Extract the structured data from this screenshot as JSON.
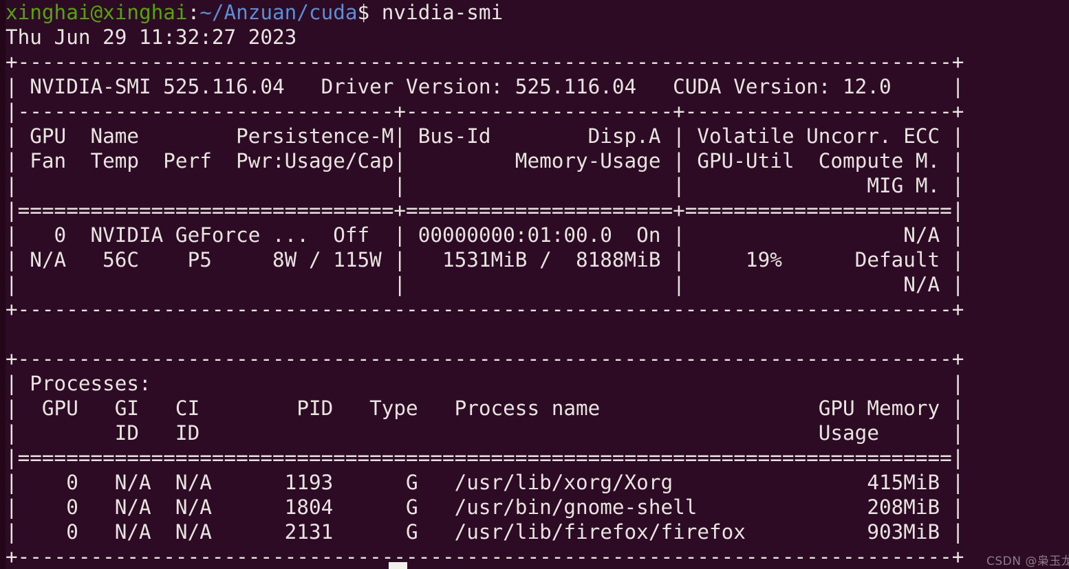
{
  "terminal": {
    "background_color": "#2d0b24",
    "foreground_color": "#e8e4e0",
    "prompt_user_color": "#55a505",
    "prompt_path_color": "#5c8ed6",
    "columns": 80,
    "watermark": "CSDN @枭玉龙"
  },
  "prompt": {
    "user_host": "xinghai@xinghai",
    "separator": ":",
    "path": "~/Anzuan/cuda",
    "sigil": "$",
    "command": " nvidia-smi"
  },
  "output": {
    "timestamp": "Thu Jun 29 11:32:27 2023",
    "smi_version_line": "| NVIDIA-SMI 525.116.04   Driver Version: 525.116.04   CUDA Version: 12.0     |",
    "smi": {
      "nvidia_smi_version": "525.116.04",
      "driver_version": "525.116.04",
      "cuda_version": "12.0"
    },
    "gpu_table": {
      "border_top": "+-----------------------------------------------------------------------------+",
      "border_mid": "|-------------------------------+----------------------+----------------------+",
      "border_double": "|===============================+======================+======================|",
      "border_bottom": "+-----------------------------------------------------------------------------+",
      "header_rows": [
        "| GPU  Name        Persistence-M| Bus-Id        Disp.A | Volatile Uncorr. ECC |",
        "| Fan  Temp  Perf  Pwr:Usage/Cap|         Memory-Usage | GPU-Util  Compute M. |",
        "|                               |                      |               MIG M. |"
      ],
      "headers": [
        "GPU",
        "Name",
        "Persistence-M",
        "Bus-Id",
        "Disp.A",
        "Volatile Uncorr. ECC",
        "Fan",
        "Temp",
        "Perf",
        "Pwr:Usage/Cap",
        "Memory-Usage",
        "GPU-Util",
        "Compute M.",
        "MIG M."
      ],
      "data_rows": [
        "|   0  NVIDIA GeForce ...  Off  | 00000000:01:00.0  On |                  N/A |",
        "| N/A   56C    P5     8W / 115W |   1531MiB /  8188MiB |     19%      Default |",
        "|                               |                      |                  N/A |"
      ],
      "gpu0": {
        "index": "0",
        "name": "NVIDIA GeForce ...",
        "persistence_m": "Off",
        "bus_id": "00000000:01:00.0",
        "disp_a": "On",
        "uncorr_ecc": "N/A",
        "fan": "N/A",
        "temp": "56C",
        "perf": "P5",
        "pwr_usage": "8W",
        "pwr_cap": "115W",
        "memory_used": "1531MiB",
        "memory_total": "8188MiB",
        "gpu_util": "19%",
        "compute_m": "Default",
        "mig_m": "N/A"
      }
    },
    "processes_table": {
      "border_top": "+-----------------------------------------------------------------------------+",
      "border_double": "|=============================================================================|",
      "border_bottom": "+-----------------------------------------------------------------------------+",
      "title_row": "| Processes:                                                                  |",
      "header_rows": [
        "|  GPU   GI   CI        PID   Type   Process name                  GPU Memory |",
        "|        ID   ID                                                   Usage      |"
      ],
      "title": "Processes:",
      "headers": [
        "GPU",
        "GI ID",
        "CI ID",
        "PID",
        "Type",
        "Process name",
        "GPU Memory Usage"
      ],
      "rows": [
        "|    0   N/A  N/A      1193      G   /usr/lib/xorg/Xorg                415MiB |",
        "|    0   N/A  N/A      1804      G   /usr/bin/gnome-shell              208MiB |",
        "|    0   N/A  N/A      2131      G   /usr/lib/firefox/firefox          903MiB |"
      ],
      "entries": [
        {
          "gpu": "0",
          "gi_id": "N/A",
          "ci_id": "N/A",
          "pid": "1193",
          "type": "G",
          "process_name": "/usr/lib/xorg/Xorg",
          "gpu_memory_usage": "415MiB"
        },
        {
          "gpu": "0",
          "gi_id": "N/A",
          "ci_id": "N/A",
          "pid": "1804",
          "type": "G",
          "process_name": "/usr/bin/gnome-shell",
          "gpu_memory_usage": "208MiB"
        },
        {
          "gpu": "0",
          "gi_id": "N/A",
          "ci_id": "N/A",
          "pid": "2131",
          "type": "G",
          "process_name": "/usr/lib/firefox/firefox",
          "gpu_memory_usage": "903MiB"
        }
      ]
    }
  }
}
